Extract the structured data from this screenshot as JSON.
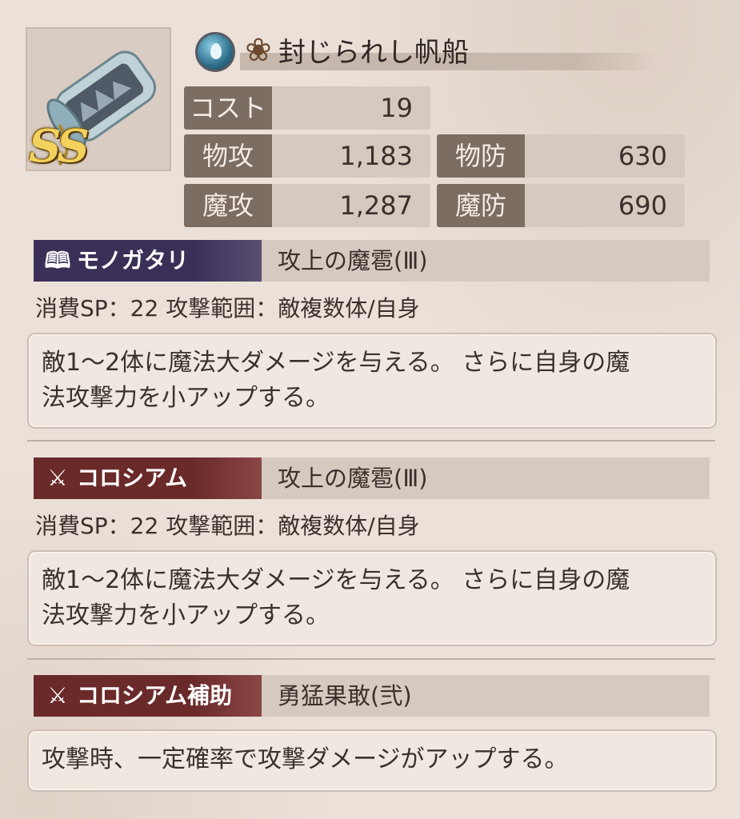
{
  "weapon": {
    "name": "封じられし帆船",
    "rarity": "SS",
    "element_icon": "water-drop-icon",
    "type_icon": "octopus-icon"
  },
  "stats": {
    "cost": {
      "label": "コスト",
      "value": "19"
    },
    "p_atk": {
      "label": "物攻",
      "value": "1,183"
    },
    "p_def": {
      "label": "物防",
      "value": "630"
    },
    "m_atk": {
      "label": "魔攻",
      "value": "1,287"
    },
    "m_def": {
      "label": "魔防",
      "value": "690"
    }
  },
  "skills": [
    {
      "badge": "モノガタリ",
      "badge_icon": "book-icon",
      "name": "攻上の魔雹(Ⅲ)",
      "sp": "消費SP：22 攻撃範囲：敵複数体/自身",
      "desc_line1": "敵1～2体に魔法大ダメージを与える。 さらに自身の魔",
      "desc_line2": "法攻撃力を小アップする。"
    },
    {
      "badge": "コロシアム",
      "badge_icon": "crossed-swords-icon",
      "name": "攻上の魔雹(Ⅲ)",
      "sp": "消費SP：22 攻撃範囲：敵複数体/自身",
      "desc_line1": "敵1～2体に魔法大ダメージを与える。 さらに自身の魔",
      "desc_line2": "法攻撃力を小アップする。"
    },
    {
      "badge": "コロシアム補助",
      "badge_icon": "crossed-swords-plus-icon",
      "name": "勇猛果敢(弐)",
      "desc_line1": "攻撃時、一定確率で攻撃ダメージがアップする。"
    }
  ]
}
